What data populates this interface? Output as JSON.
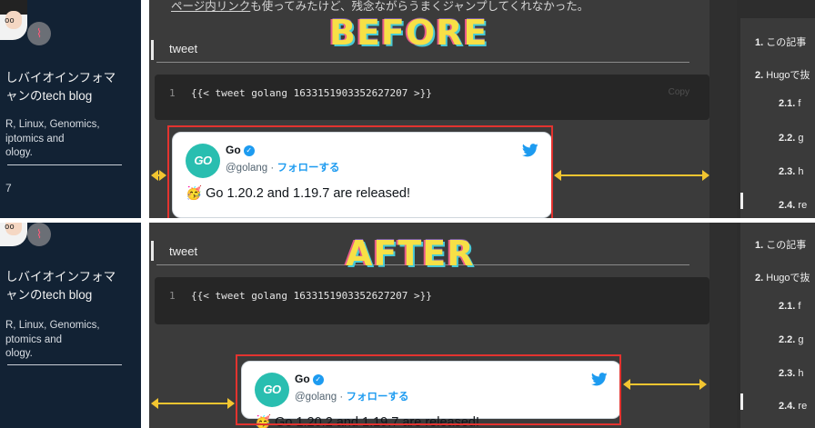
{
  "labels": {
    "before": "BEFORE",
    "after": "AFTER"
  },
  "sidebar": {
    "title_line1": "しバイオインフォマ",
    "title_line2": "ャンのtech blog",
    "desc_line1": "R, Linux, Genomics,",
    "desc_line2_before": "iptomics and",
    "desc_line2_after": "ptomics and",
    "desc_line3": "ology.",
    "fragment": "7"
  },
  "article": {
    "top_text_link": "ページ内リンク",
    "top_text_rest": "も使ってみたけど、残念ながらうまくジャンプしてくれなかった。",
    "heading": "tweet",
    "code_line_number": "1",
    "code_text": "{{< tweet golang 1633151903352627207 >}}",
    "copy_label": "Copy"
  },
  "tweet": {
    "avatar_text": "GO",
    "name": "Go",
    "verified_mark": "✓",
    "handle": "@golang",
    "separator": " · ",
    "follow": "フォローする",
    "emoji": "🥳",
    "text": "Go 1.20.2 and 1.19.7 are released!"
  },
  "toc": {
    "item1_num": "1.",
    "item1": "この記事",
    "item2_num": "2.",
    "item2": "Hugoで抜",
    "sub1_num": "2.1.",
    "sub1": "f",
    "sub2_num": "2.2.",
    "sub2": "g",
    "sub3_num": "2.3.",
    "sub3": "h",
    "sub4_num": "2.4.",
    "sub4": "re"
  },
  "colors": {
    "sidebar_bg": "#122234",
    "main_bg": "#3b3b3b",
    "code_bg": "#262626",
    "twitter_blue": "#1d9bf0",
    "go_teal": "#29beb0",
    "highlight_red": "#e3332f",
    "arrow_yellow": "#f2c530",
    "label_yellow": "#f7e046"
  },
  "icons": [
    "avatar-illustration",
    "dna-icon",
    "verified-icon",
    "twitter-bird-icon",
    "party-emoji-icon",
    "double-arrow-icon"
  ]
}
